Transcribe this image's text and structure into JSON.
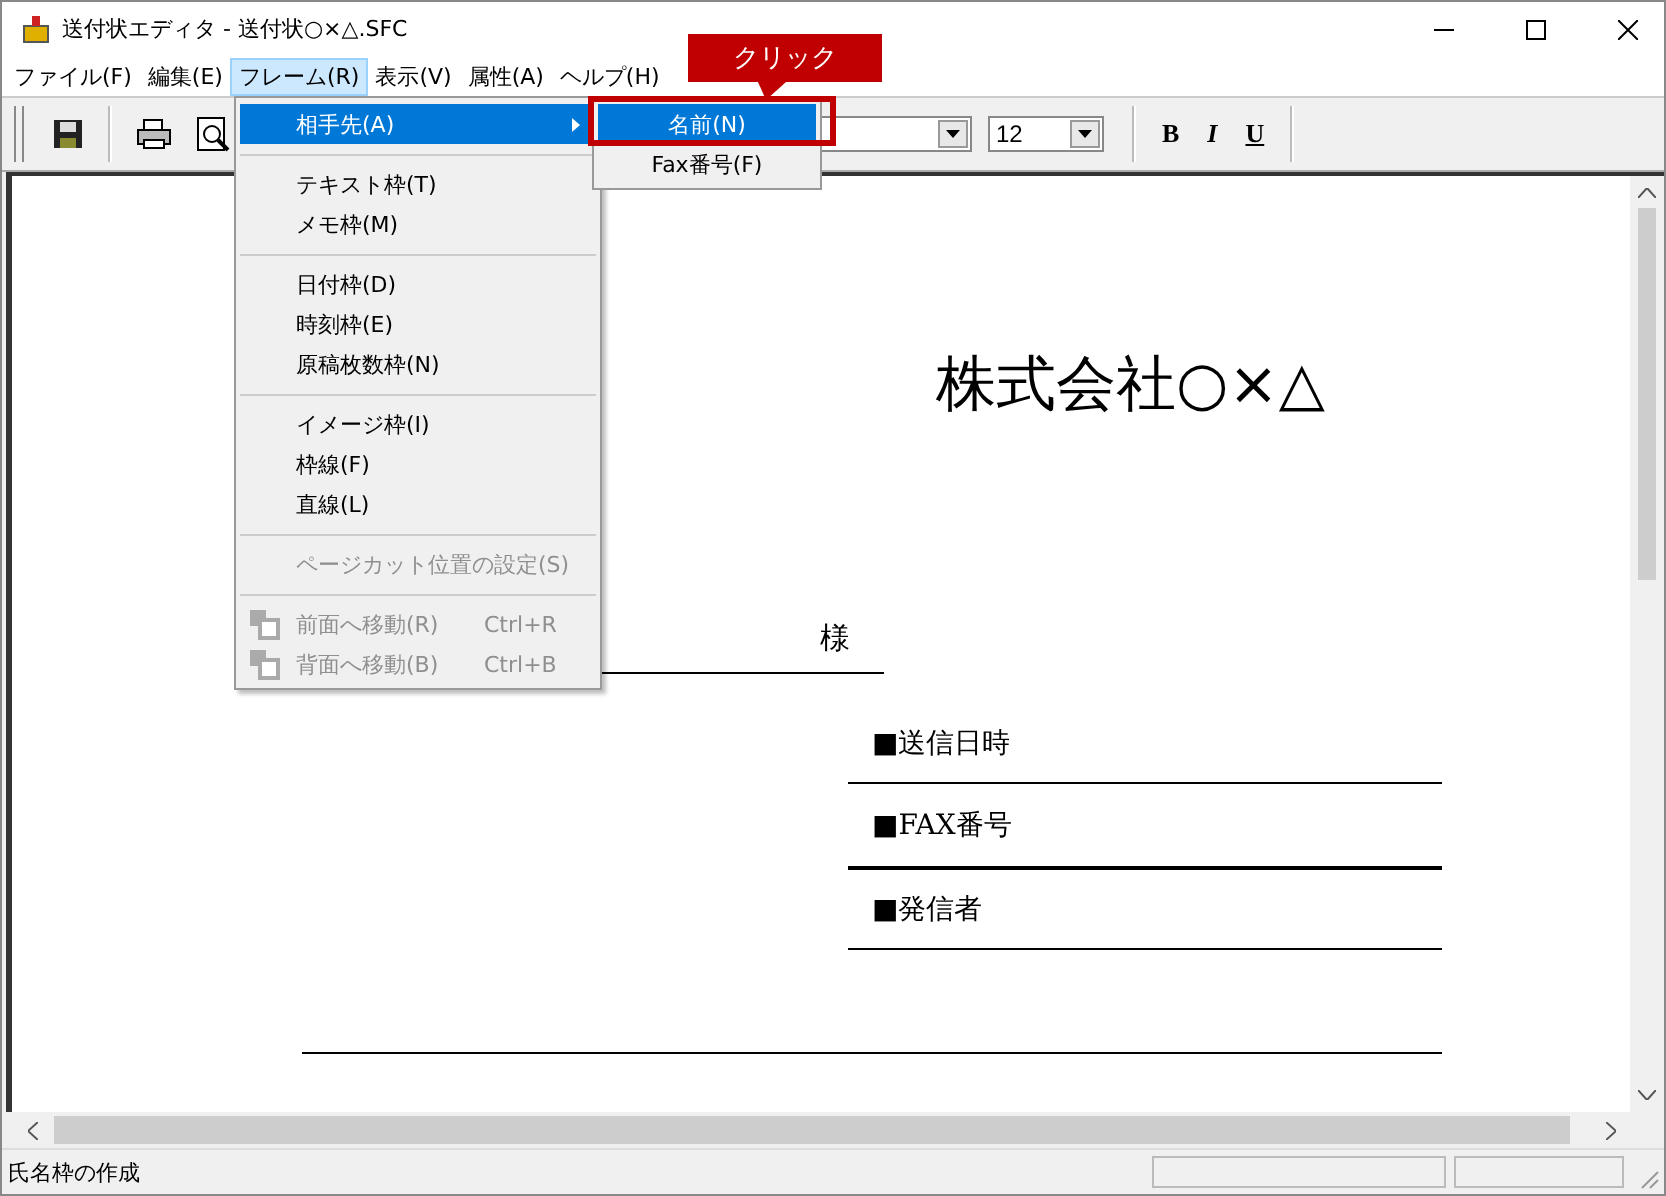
{
  "window": {
    "title": "送付状エディタ - 送付状○×△.SFC"
  },
  "menubar": [
    {
      "label": "ファイル(F)",
      "selected": false
    },
    {
      "label": "編集(E)",
      "selected": false
    },
    {
      "label": "フレーム(R)",
      "selected": true
    },
    {
      "label": "表示(V)",
      "selected": false
    },
    {
      "label": "属性(A)",
      "selected": false
    },
    {
      "label": "ヘルプ(H)",
      "selected": false
    }
  ],
  "toolbar": {
    "font_size": "12",
    "styles": [
      {
        "kind": "bold",
        "label": "B"
      },
      {
        "kind": "italic",
        "label": "I"
      },
      {
        "kind": "underline",
        "label": "U"
      }
    ]
  },
  "frame_menu": [
    {
      "kind": "item",
      "label": "相手先(A)",
      "submenu": true,
      "selected": true,
      "disabled": false
    },
    {
      "kind": "separator"
    },
    {
      "kind": "item",
      "label": "テキスト枠(T)",
      "selected": false,
      "disabled": false
    },
    {
      "kind": "item",
      "label": "メモ枠(M)",
      "selected": false,
      "disabled": false
    },
    {
      "kind": "separator"
    },
    {
      "kind": "item",
      "label": "日付枠(D)",
      "selected": false,
      "disabled": false
    },
    {
      "kind": "item",
      "label": "時刻枠(E)",
      "selected": false,
      "disabled": false
    },
    {
      "kind": "item",
      "label": "原稿枚数枠(N)",
      "selected": false,
      "disabled": false
    },
    {
      "kind": "separator"
    },
    {
      "kind": "item",
      "label": "イメージ枠(I)",
      "selected": false,
      "disabled": false
    },
    {
      "kind": "item",
      "label": "枠線(F)",
      "selected": false,
      "disabled": false
    },
    {
      "kind": "item",
      "label": "直線(L)",
      "selected": false,
      "disabled": false
    },
    {
      "kind": "separator"
    },
    {
      "kind": "item",
      "label": "ページカット位置の設定(S)",
      "selected": false,
      "disabled": true
    },
    {
      "kind": "separator"
    },
    {
      "kind": "command",
      "label": "前面へ移動(R)",
      "shortcut": "Ctrl+R",
      "selected": false,
      "disabled": true
    },
    {
      "kind": "command",
      "label": "背面へ移動(B)",
      "shortcut": "Ctrl+B",
      "selected": false,
      "disabled": true
    }
  ],
  "submenu": [
    {
      "label": "名前(N)",
      "selected": true
    },
    {
      "label": "Fax番号(F)",
      "selected": false
    }
  ],
  "callout": {
    "text": "クリック"
  },
  "document": {
    "company": "株式会社○×△",
    "recipient_suffix": "様",
    "fields": [
      {
        "label": "■送信日時"
      },
      {
        "label": "■FAX番号"
      },
      {
        "label": "■発信者"
      }
    ]
  },
  "status_bar": {
    "text": "氏名枠の作成"
  }
}
